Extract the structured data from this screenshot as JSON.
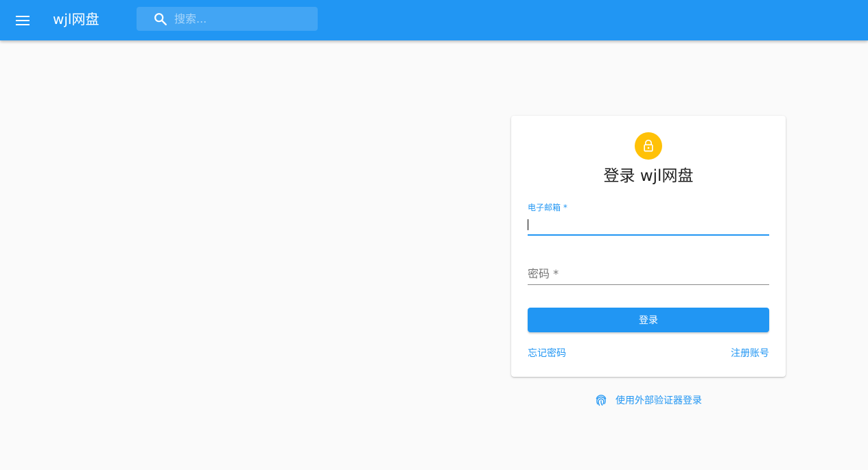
{
  "header": {
    "menu_icon": "menu-icon",
    "brand": "wjl网盘",
    "search_icon": "search-icon",
    "search_placeholder": "搜索..."
  },
  "login_card": {
    "avatar_icon": "lock-icon",
    "title": "登录 wjl网盘",
    "email_label": "电子邮箱 *",
    "email_value": "",
    "password_label": "密码 *",
    "submit_label": "登录",
    "forgot_label": "忘记密码",
    "register_label": "注册账号"
  },
  "external_login": {
    "icon": "fingerprint-icon",
    "label": "使用外部验证器登录"
  },
  "colors": {
    "primary": "#2196f3",
    "avatar": "#ffc107",
    "background": "#fafafa"
  }
}
